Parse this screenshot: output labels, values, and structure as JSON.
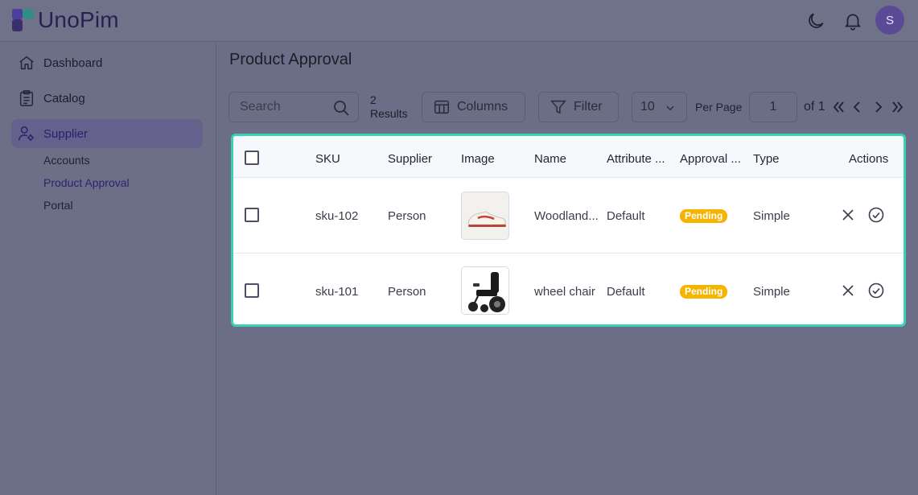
{
  "app": {
    "brand": "UnoPim",
    "user_initial": "S"
  },
  "header": {
    "icons": [
      "moon-icon",
      "bell-icon"
    ]
  },
  "sidebar": {
    "items": [
      {
        "label": "Dashboard",
        "icon": "home-icon"
      },
      {
        "label": "Catalog",
        "icon": "clipboard-icon"
      },
      {
        "label": "Supplier",
        "icon": "users-gear-icon",
        "active": true
      }
    ],
    "subitems": [
      {
        "label": "Accounts"
      },
      {
        "label": "Product Approval",
        "active": true
      },
      {
        "label": "Portal"
      }
    ]
  },
  "main": {
    "title": "Product Approval",
    "search": {
      "placeholder": "Search"
    },
    "results": {
      "count": "2",
      "label": "Results"
    },
    "columns_label": "Columns",
    "filter_label": "Filter",
    "per_page": {
      "value": "10",
      "label": "Per Page"
    },
    "page": {
      "current": "1",
      "of": "of 1"
    }
  },
  "table": {
    "headers": [
      "SKU",
      "Supplier",
      "Image",
      "Name",
      "Attribute ...",
      "Approval ...",
      "Type",
      "Actions"
    ],
    "rows": [
      {
        "sku": "sku-102",
        "supplier": "Person",
        "image": "sneaker-image",
        "name": "Woodland...",
        "attribute": "Default",
        "approval": "Pending",
        "type": "Simple"
      },
      {
        "sku": "sku-101",
        "supplier": "Person",
        "image": "wheelchair-image",
        "name": "wheel chair",
        "attribute": "Default",
        "approval": "Pending",
        "type": "Simple"
      }
    ]
  },
  "colors": {
    "accent_border": "#35d3b0",
    "pending_badge": "#f4b400",
    "brand": "#2a1f55"
  }
}
